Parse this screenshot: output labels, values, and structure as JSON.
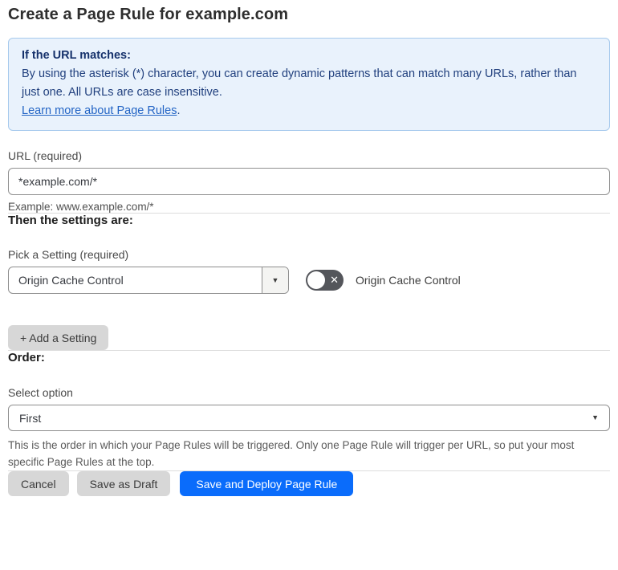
{
  "page": {
    "title": "Create a Page Rule for example.com"
  },
  "info_box": {
    "heading": "If the URL matches:",
    "body": "By using the asterisk (*) character, you can create dynamic patterns that can match many URLs, rather than just one. All URLs are case insensitive.",
    "link": "Learn more about Page Rules",
    "link_suffix": "."
  },
  "url_field": {
    "label": "URL (required)",
    "value": "*example.com/*",
    "example": "Example: www.example.com/*"
  },
  "settings_section": {
    "heading": "Then the settings are:",
    "picker_label": "Pick a Setting (required)",
    "picker_value": "Origin Cache Control",
    "toggle_label": "Origin Cache Control",
    "toggle_state": "off",
    "add_setting_button": "+ Add a Setting"
  },
  "order_section": {
    "heading": "Order:",
    "select_label": "Select option",
    "select_value": "First",
    "help_text": "This is the order in which your Page Rules will be triggered. Only one Page Rule will trigger per URL, so put your most specific Page Rules at the top."
  },
  "footer": {
    "cancel_label": "Cancel",
    "save_draft_label": "Save as Draft",
    "save_deploy_label": "Save and Deploy Page Rule"
  },
  "icons": {
    "chevron_down": "▼",
    "toggle_x": "✕"
  },
  "colors": {
    "accent_blue": "#0a6cfb",
    "info_background": "#e9f2fc",
    "info_border": "#a6c9ed",
    "info_text": "#21407e",
    "link_blue": "#2264c5",
    "toggle_off_background": "#54565b",
    "gray_button": "#d7d7d7"
  }
}
